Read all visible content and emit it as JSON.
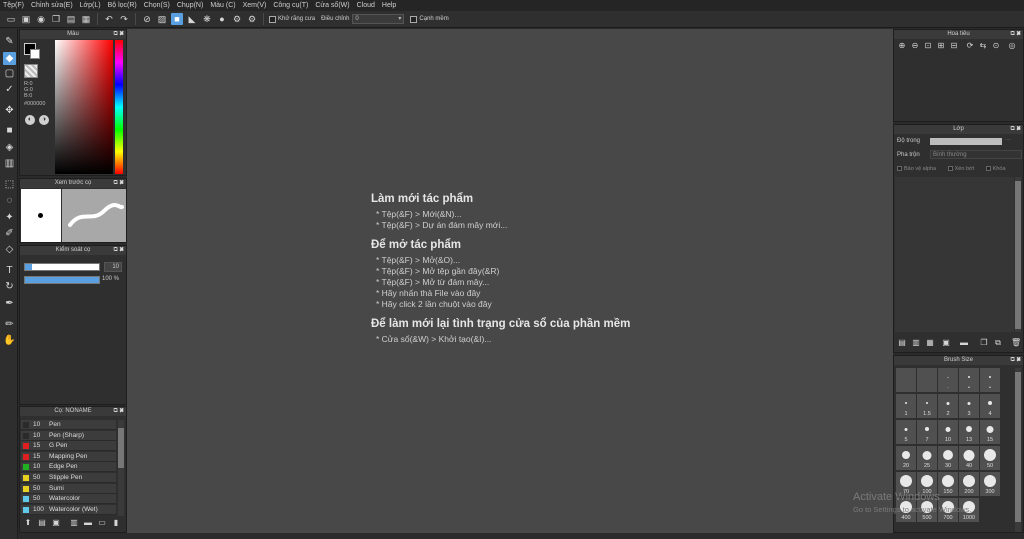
{
  "menu": [
    "Tệp(F)",
    "Chỉnh sửa(E)",
    "Lớp(L)",
    "Bộ lọc(R)",
    "Chọn(S)",
    "Chụp(N)",
    "Màu (C)",
    "Xem(V)",
    "Công cụ(T)",
    "Cửa sổ(W)",
    "Cloud",
    "Help"
  ],
  "toolbar": {
    "antialias_label": "Khử răng cưa",
    "adjust_label": "Điều chỉnh",
    "adjust_value": "0",
    "edge_label": "Cạnh mềm"
  },
  "color_panel": {
    "title": "Màu",
    "r": "R:0",
    "g": "G:0",
    "b": "B:0",
    "hex": "#000000",
    "main_color": "#000000",
    "sub_color": "#ffffff"
  },
  "preview_panel": {
    "title": "Xem trước cọ"
  },
  "control_panel": {
    "title": "Kiểm soát cọ",
    "size_value": "10",
    "opacity_value": "100 %",
    "size_fraction": 0.1,
    "opacity_fraction": 1.0
  },
  "brush_panel": {
    "title": "Cọ: NONAME",
    "brushes": [
      {
        "size": "10",
        "name": "Pen",
        "color": "#2a2a2a"
      },
      {
        "size": "10",
        "name": "Pen (Sharp)",
        "color": "#2a2a2a"
      },
      {
        "size": "15",
        "name": "G Pen",
        "color": "#e02020"
      },
      {
        "size": "15",
        "name": "Mapping Pen",
        "color": "#e02020"
      },
      {
        "size": "10",
        "name": "Edge Pen",
        "color": "#20b020"
      },
      {
        "size": "50",
        "name": "Stipple Pen",
        "color": "#e8d020"
      },
      {
        "size": "50",
        "name": "Sumi",
        "color": "#e8d020"
      },
      {
        "size": "50",
        "name": "Watercolor",
        "color": "#60c8e8"
      },
      {
        "size": "100",
        "name": "Watercolor (Wet)",
        "color": "#60c8e8"
      }
    ]
  },
  "welcome": {
    "h1": "Làm mới tác phẩm",
    "g1": [
      "* Tệp(&F) > Mới(&N)...",
      "* Tệp(&F) > Dự án đám mây mới..."
    ],
    "h2": "Để mở tác phẩm",
    "g2": [
      "* Tệp(&F) > Mở(&O)...",
      "* Tệp(&F) > Mở tệp gần đây(&R)",
      "* Tệp(&F) > Mở từ đám mây...",
      "* Hãy nhấn thả File vào đây",
      "* Hãy click 2 lần chuột vào đây"
    ],
    "h3": "Để làm mới lại tình trạng cửa sổ của phần mềm",
    "g3": [
      "* Cửa sổ(&W) > Khởi tạo(&I)..."
    ]
  },
  "navigator": {
    "title": "Hoa tiêu"
  },
  "layer_panel": {
    "title": "Lớp",
    "opacity_label": "Độ trong",
    "blend_label": "Pha trộn",
    "blend_value": "Bình thường",
    "protect_alpha": "Bảo vệ alpha",
    "clipping": "Xén bớt",
    "lock": "Khóa"
  },
  "brush_size": {
    "title": "Brush Size",
    "sizes": [
      "",
      "",
      "·",
      "•",
      "•",
      "1",
      "1.5",
      "2",
      "3",
      "4",
      "5",
      "7",
      "10",
      "13",
      "15",
      "20",
      "25",
      "30",
      "40",
      "50",
      "70",
      "100",
      "150",
      "200",
      "300",
      "400",
      "500",
      "700",
      "1000"
    ]
  },
  "watermark": {
    "line1": "Activate Windows",
    "line2": "Go to Settings to activate Windows."
  }
}
